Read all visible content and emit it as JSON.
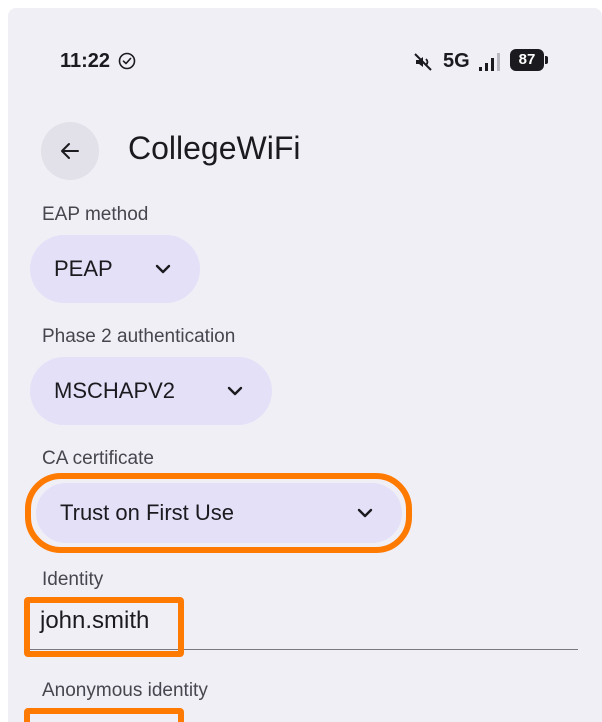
{
  "status_bar": {
    "time": "11:22",
    "network": "5G",
    "battery": "87",
    "icons": [
      "check-circle-icon",
      "mute-icon",
      "signal-icon",
      "battery-icon"
    ]
  },
  "header": {
    "back_icon": "arrow-back-icon",
    "title": "CollegeWiFi"
  },
  "fields": {
    "eap_method": {
      "label": "EAP method",
      "value": "PEAP"
    },
    "phase2": {
      "label": "Phase 2 authentication",
      "value": "MSCHAPV2"
    },
    "ca_certificate": {
      "label": "CA certificate",
      "value": "Trust on First Use"
    },
    "identity": {
      "label": "Identity",
      "value": "john.smith"
    },
    "anonymous_identity": {
      "label": "Anonymous identity"
    }
  },
  "colors": {
    "background": "#f1eff6",
    "dropdown_fill": "#e3e0f8",
    "highlight": "#ff7a00"
  }
}
